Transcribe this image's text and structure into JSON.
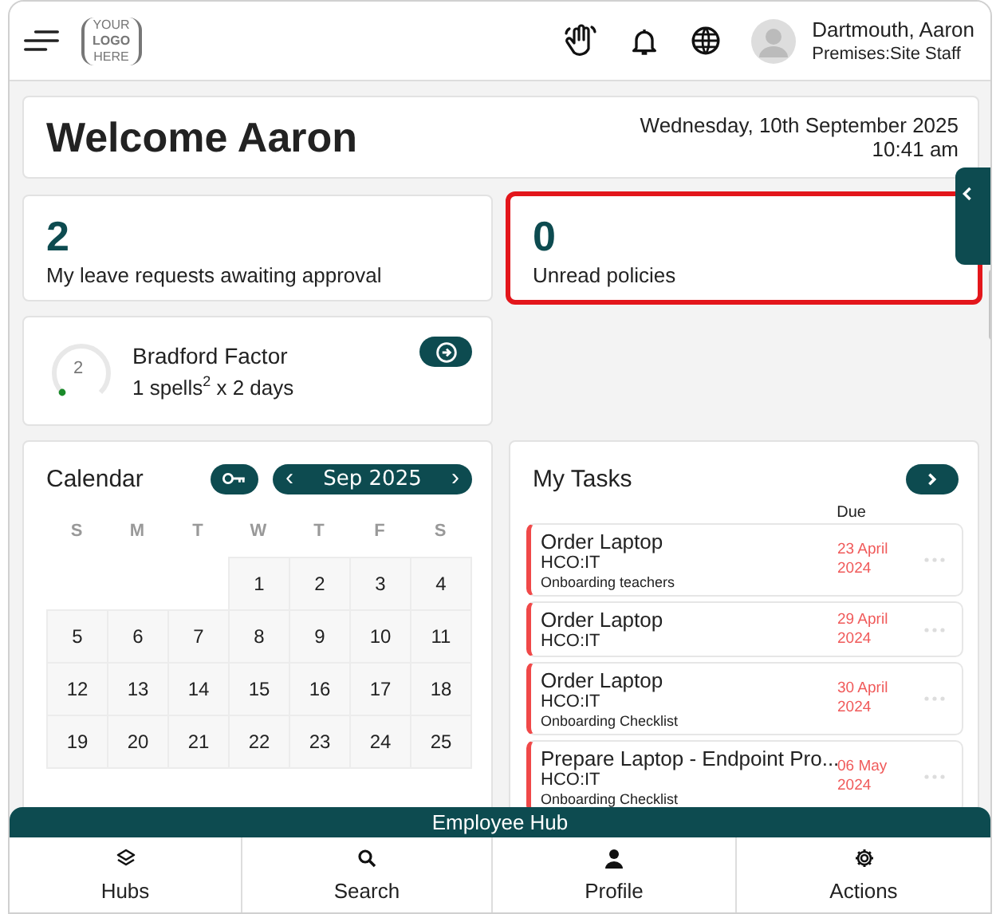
{
  "header": {
    "logo_lines": [
      "YOUR",
      "LOGO",
      "HERE"
    ],
    "user": {
      "name": "Dartmouth, Aaron",
      "role": "Premises:Site Staff"
    }
  },
  "welcome": {
    "title": "Welcome Aaron",
    "date": "Wednesday, 10th September 2025",
    "time": "10:41 am"
  },
  "stats": [
    {
      "value": "2",
      "label": "My leave requests awaiting approval",
      "highlighted": false
    },
    {
      "value": "0",
      "label": "Unread policies",
      "highlighted": true
    }
  ],
  "bradford": {
    "score": "2",
    "title": "Bradford Factor",
    "detail": "1 spells$^{2}$ x 2 days"
  },
  "calendar": {
    "title": "Calendar",
    "month": "Sep 2025",
    "prev": "‹",
    "next": "›",
    "weekdays": [
      "S",
      "M",
      "T",
      "W",
      "T",
      "F",
      "S"
    ],
    "weeks": [
      [
        {
          "kind": "blank"
        },
        {
          "kind": "blank"
        },
        {
          "kind": "blank"
        },
        {
          "kind": "day",
          "label": "1"
        },
        {
          "kind": "day",
          "label": "2"
        },
        {
          "kind": "day",
          "label": "3"
        },
        {
          "kind": "day",
          "label": "4"
        }
      ],
      [
        {
          "kind": "day",
          "label": "5"
        },
        {
          "kind": "day",
          "label": "6"
        },
        {
          "kind": "day",
          "label": "7"
        },
        {
          "kind": "day",
          "label": "8"
        },
        {
          "kind": "day",
          "label": "9"
        },
        {
          "kind": "day",
          "label": "10"
        },
        {
          "kind": "day",
          "label": "11"
        }
      ],
      [
        {
          "kind": "day",
          "label": "12"
        },
        {
          "kind": "day",
          "label": "13"
        },
        {
          "kind": "day",
          "label": "14"
        },
        {
          "kind": "day",
          "label": "15"
        },
        {
          "kind": "day",
          "label": "16"
        },
        {
          "kind": "day",
          "label": "17"
        },
        {
          "kind": "day",
          "label": "18"
        }
      ],
      [
        {
          "kind": "day",
          "label": "19"
        },
        {
          "kind": "day",
          "label": "20"
        },
        {
          "kind": "day",
          "label": "21"
        },
        {
          "kind": "day",
          "label": "22"
        },
        {
          "kind": "day",
          "label": "23"
        },
        {
          "kind": "day",
          "label": "24"
        },
        {
          "kind": "day",
          "label": "25"
        }
      ]
    ]
  },
  "tasks": {
    "title": "My Tasks",
    "due_heading": "Due",
    "items": [
      {
        "title": "Order Laptop",
        "category": "HCO:IT",
        "checklist": "Onboarding teachers",
        "due": "23 April 2024",
        "overdue": true
      },
      {
        "title": "Order Laptop",
        "category": "HCO:IT",
        "due": "29 April 2024",
        "overdue": true
      },
      {
        "title": "Order Laptop",
        "category": "HCO:IT",
        "checklist": "Onboarding Checklist",
        "due": "30 April 2024",
        "overdue": true
      },
      {
        "title": "Prepare Laptop - Endpoint Pro...",
        "category": "HCO:IT",
        "checklist": "Onboarding Checklist",
        "due": "06 May 2024",
        "overdue": true
      }
    ]
  },
  "bottom_nav": {
    "title": "Employee Hub",
    "items": [
      {
        "label": "Hubs"
      },
      {
        "label": "Search"
      },
      {
        "label": "Profile"
      },
      {
        "label": "Actions"
      }
    ]
  }
}
